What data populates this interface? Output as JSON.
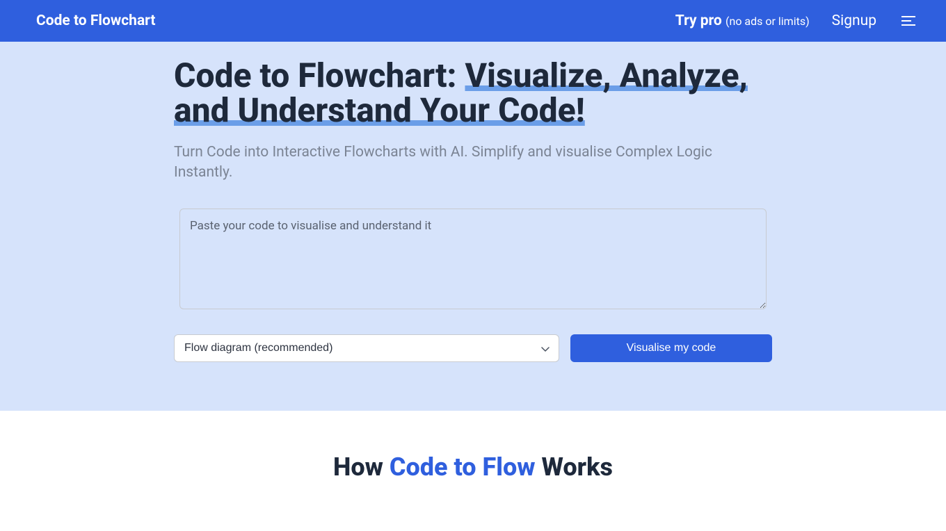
{
  "header": {
    "logo": "Code to Flowchart",
    "try_pro": "Try pro",
    "try_pro_sub": "(no ads or limits)",
    "signup": "Signup"
  },
  "hero": {
    "title_prefix": "Code to Flowchart: ",
    "title_highlight": "Visualize, Analyze, and Understand Your Code!",
    "subtitle": "Turn Code into Interactive Flowcharts with AI. Simplify and visualise Complex Logic Instantly.",
    "textarea_placeholder": "Paste your code to visualise and understand it",
    "select_value": "Flow diagram (recommended)",
    "button_label": "Visualise my code"
  },
  "how": {
    "prefix": "How ",
    "accent": "Code to Flow",
    "suffix": " Works"
  }
}
